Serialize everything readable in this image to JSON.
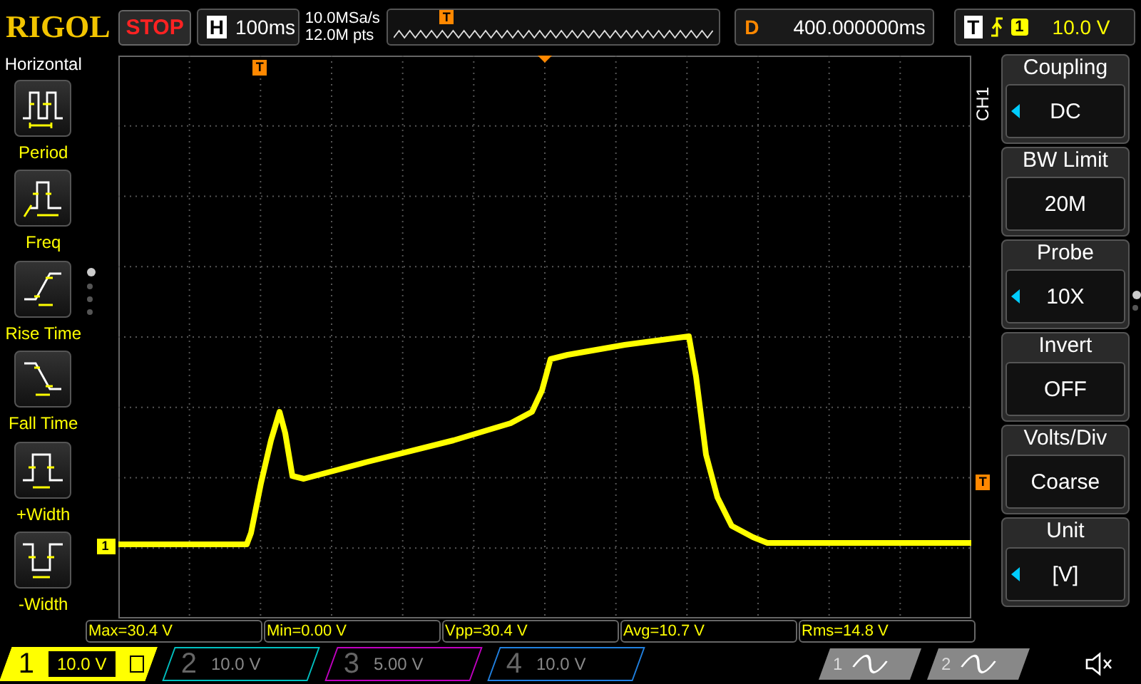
{
  "brand": "RIGOL",
  "run_state": "STOP",
  "timebase": {
    "label": "H",
    "value": "100ms"
  },
  "acquisition": {
    "sample_rate": "10.0MSa/s",
    "memory_depth": "12.0M pts"
  },
  "overview": {
    "marker": "T"
  },
  "delay": {
    "label": "D",
    "value": "400.000000ms"
  },
  "trigger": {
    "label": "T",
    "source": "1",
    "level": "10.0 V"
  },
  "grid": {
    "trigger_position_marker": "T",
    "channel_marker": "1",
    "trigger_level_marker": "T"
  },
  "measure_menu": {
    "title": "Horizontal",
    "items": [
      {
        "kind": "period",
        "label": "Period"
      },
      {
        "kind": "freq",
        "label": "Freq"
      },
      {
        "kind": "rise",
        "label": "Rise Time"
      },
      {
        "kind": "fall",
        "label": "Fall Time"
      },
      {
        "kind": "pwidth",
        "label": "+Width"
      },
      {
        "kind": "nwidth",
        "label": "-Width"
      }
    ],
    "pages": [
      {
        "selected": true
      },
      {
        "selected": false
      },
      {
        "selected": false
      },
      {
        "selected": false
      }
    ]
  },
  "channel_menu": {
    "channel": "CH1",
    "items": [
      {
        "title": "Coupling",
        "value": "DC",
        "adjustable": true
      },
      {
        "title": "BW Limit",
        "value": "20M",
        "adjustable": false
      },
      {
        "title": "Probe",
        "value": "10X",
        "adjustable": true
      },
      {
        "title": "Invert",
        "value": "OFF",
        "adjustable": false
      },
      {
        "title": "Volts/Div",
        "value": "Coarse",
        "adjustable": false
      },
      {
        "title": "Unit",
        "value": "[V]",
        "adjustable": true
      }
    ],
    "pages": [
      {
        "selected": true
      },
      {
        "selected": false
      }
    ]
  },
  "measurements": [
    "Max=30.4 V",
    "Min=0.00 V",
    "Vpp=30.4 V",
    "Avg=10.7 V",
    "Rms=14.8 V"
  ],
  "channels": [
    {
      "number": "1",
      "scale": "10.0 V",
      "active": true,
      "color": "#ffff00"
    },
    {
      "number": "2",
      "scale": "10.0 V",
      "active": false,
      "color": "#00c0c0"
    },
    {
      "number": "3",
      "scale": "5.00 V",
      "active": false,
      "color": "#c000c0"
    },
    {
      "number": "4",
      "scale": "10.0 V",
      "active": false,
      "color": "#2080e0"
    }
  ],
  "math": [
    {
      "number": "1"
    },
    {
      "number": "2"
    }
  ]
}
